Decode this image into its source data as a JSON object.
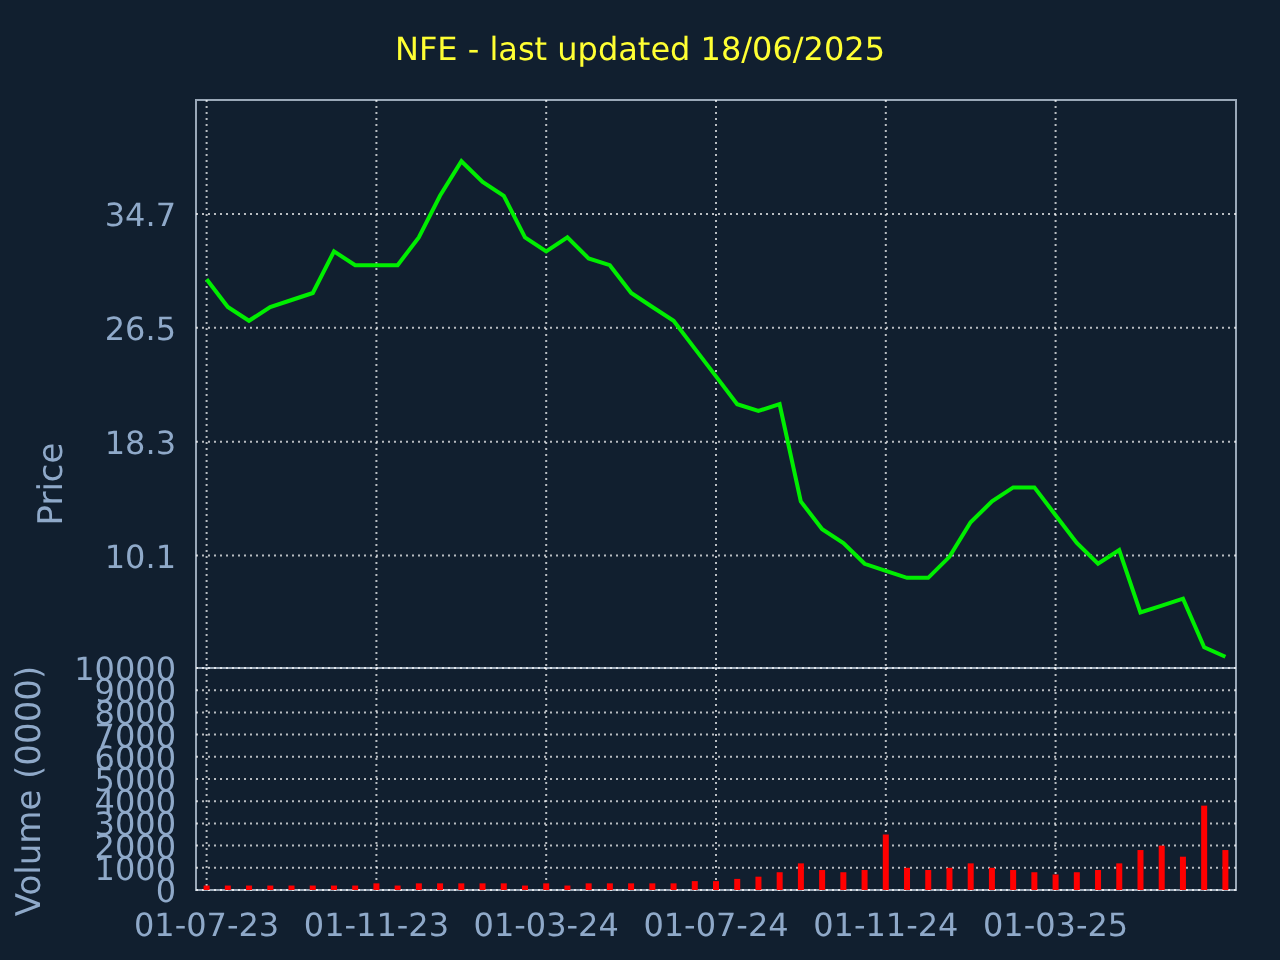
{
  "charts": [
    {
      "chart_data": {
        "type": "line",
        "grid": true,
        "title": "NFE - last updated 18/06/2025",
        "ylabel": "Price",
        "ylim": [
          2.0,
          42.9
        ],
        "yticks": [
          {
            "value": 10.1,
            "label": "10.1"
          },
          {
            "value": 18.3,
            "label": "18.3"
          },
          {
            "value": 26.5,
            "label": "26.5"
          },
          {
            "value": 34.7,
            "label": "34.7"
          }
        ],
        "series": [
          {
            "color": "#00ee00",
            "values": [
              30,
              28,
              27,
              28,
              28.5,
              29,
              32,
              31,
              31,
              31,
              33,
              36,
              38.5,
              37,
              36,
              33,
              32,
              33,
              31.5,
              31,
              29,
              28,
              27,
              25,
              23,
              21,
              20.5,
              21,
              14,
              12,
              11,
              9.5,
              9,
              8.5,
              8.5,
              10,
              12.5,
              14,
              15,
              15,
              13,
              11,
              9.5,
              10.5,
              6,
              6.5,
              7,
              3.5,
              2.8
            ]
          }
        ]
      }
    },
    {
      "chart_data": {
        "type": "bar",
        "grid": true,
        "ylabel": "Volume (0000)",
        "ylim": [
          0,
          10000
        ],
        "categories": [
          "01-07-23",
          null,
          null,
          null,
          null,
          null,
          null,
          null,
          "01-11-23",
          null,
          null,
          null,
          null,
          null,
          null,
          null,
          "01-03-24",
          null,
          null,
          null,
          null,
          null,
          null,
          null,
          "01-07-24",
          null,
          null,
          null,
          null,
          null,
          null,
          null,
          "01-11-24",
          null,
          null,
          null,
          null,
          null,
          null,
          null,
          "01-03-25",
          null,
          null,
          null,
          null,
          null,
          null,
          null,
          null
        ],
        "yticks": [
          {
            "value": 0,
            "label": "0"
          },
          {
            "value": 1000,
            "label": "1000"
          },
          {
            "value": 2000,
            "label": "2000"
          },
          {
            "value": 3000,
            "label": "3000"
          },
          {
            "value": 4000,
            "label": "4000"
          },
          {
            "value": 5000,
            "label": "5000"
          },
          {
            "value": 6000,
            "label": "6000"
          },
          {
            "value": 7000,
            "label": "7000"
          },
          {
            "value": 8000,
            "label": "8000"
          },
          {
            "value": 9000,
            "label": "9000"
          },
          {
            "value": 10000,
            "label": "10000"
          }
        ],
        "series": [
          {
            "color": "#ff0000",
            "values": [
              200,
              200,
              200,
              200,
              200,
              200,
              200,
              200,
              300,
              200,
              300,
              300,
              300,
              300,
              300,
              200,
              300,
              200,
              300,
              300,
              300,
              300,
              300,
              400,
              400,
              500,
              600,
              800,
              1200,
              900,
              800,
              900,
              2500,
              1000,
              900,
              1000,
              1200,
              1000,
              900,
              800,
              700,
              800,
              900,
              1200,
              1800,
              2000,
              1500,
              3800,
              1800
            ]
          }
        ]
      }
    }
  ]
}
